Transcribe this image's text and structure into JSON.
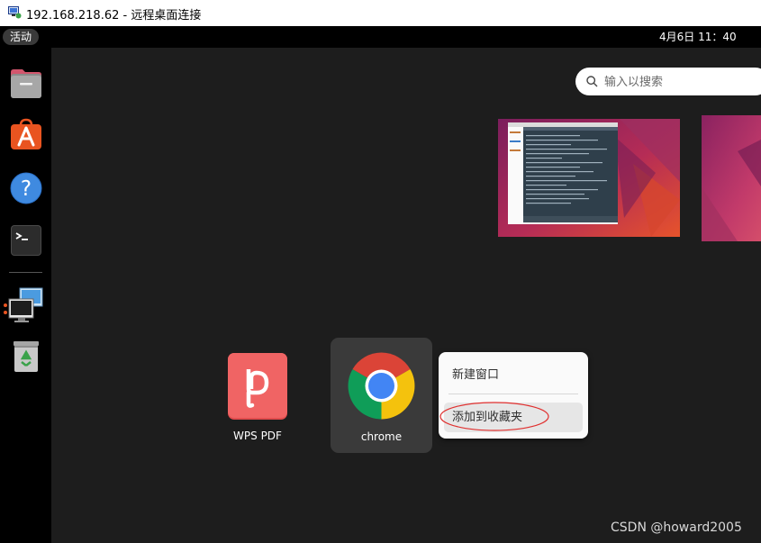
{
  "window": {
    "title": "192.168.218.62 - 远程桌面连接"
  },
  "topbar": {
    "activities_label": "活动",
    "clock": "4月6日 11：40"
  },
  "dock": {
    "items": [
      {
        "name": "files",
        "icon": "file-manager-icon"
      },
      {
        "name": "software",
        "icon": "app-store-icon"
      },
      {
        "name": "help",
        "icon": "help-icon"
      },
      {
        "name": "terminal",
        "icon": "terminal-icon"
      },
      {
        "name": "remote-desktop",
        "icon": "remote-desktop-icon",
        "running": true
      },
      {
        "name": "trash",
        "icon": "trash-icon"
      }
    ]
  },
  "search": {
    "placeholder": "输入以搜索"
  },
  "apps": [
    {
      "label": "WPS PDF",
      "icon": "wps-pdf-icon"
    },
    {
      "label": "chrome",
      "icon": "chrome-icon"
    }
  ],
  "context_menu": {
    "new_window": "新建窗口",
    "add_favorite": "添加到收藏夹"
  },
  "colors": {
    "accent": "#e95420",
    "background": "#1d1d1d",
    "panel": "#000000"
  },
  "watermark": "CSDN @howard2005"
}
